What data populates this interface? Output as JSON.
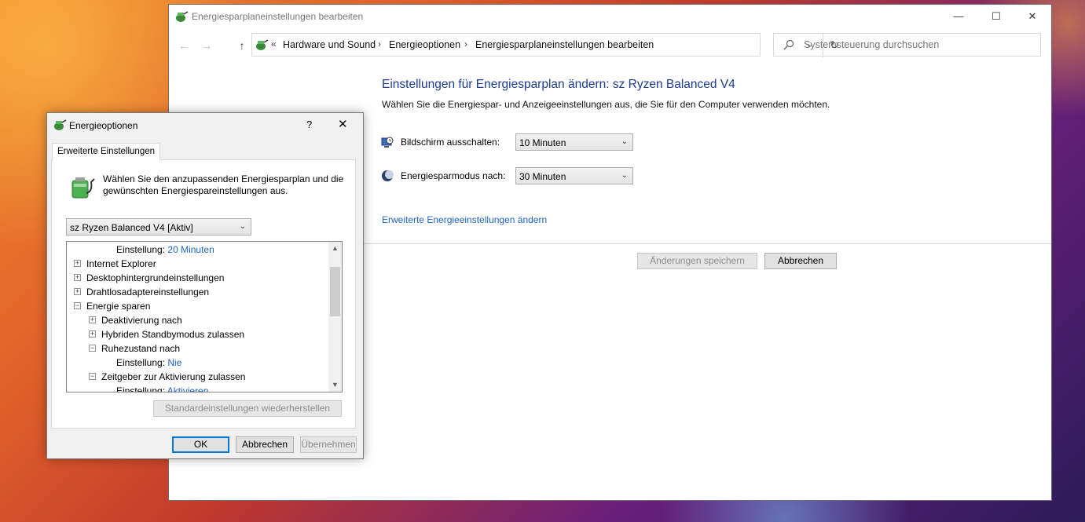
{
  "main_window": {
    "title": "Energiesparplaneinstellungen bearbeiten",
    "controls": {
      "minimize": "—",
      "maximize": "☐",
      "close": "✕"
    },
    "nav": {
      "back": "←",
      "forward": "→",
      "up": "↑"
    },
    "breadcrumb": {
      "overflow": "«",
      "items": [
        "Hardware und Sound",
        "Energieoptionen",
        "Energiesparplaneinstellungen bearbeiten"
      ],
      "separator": "›"
    },
    "refresh": "↻",
    "search_placeholder": "Systemsteuerung durchsuchen",
    "heading": "Einstellungen für Energiesparplan ändern: sz Ryzen Balanced V4",
    "subheading": "Wählen Sie die Energiespar- und Anzeigeeinstellungen aus, die Sie für den Computer verwenden möchten.",
    "settings": [
      {
        "label": "Bildschirm ausschalten:",
        "value": "10 Minuten",
        "icon": "monitor-clock-icon"
      },
      {
        "label": "Energiesparmodus nach:",
        "value": "30 Minuten",
        "icon": "moon-icon"
      }
    ],
    "advanced_link": "Erweiterte Energieeinstellungen ändern",
    "save_button": "Änderungen speichern",
    "cancel_button": "Abbrechen"
  },
  "dialog": {
    "title": "Energieoptionen",
    "help": "?",
    "close": "✕",
    "tab": "Erweiterte Einstellungen",
    "description": "Wählen Sie den anzupassenden Energiesparplan und die gewünschten Energiespareinstellungen aus.",
    "plan_select": "sz Ryzen Balanced V4 [Aktiv]",
    "tree": [
      {
        "level": 2,
        "expander": "",
        "label": "Einstellung:",
        "value": "20 Minuten"
      },
      {
        "level": 0,
        "expander": "+",
        "label": "Internet Explorer",
        "value": ""
      },
      {
        "level": 0,
        "expander": "+",
        "label": "Desktophintergrundeinstellungen",
        "value": ""
      },
      {
        "level": 0,
        "expander": "+",
        "label": "Drahtlosadaptereinstellungen",
        "value": ""
      },
      {
        "level": 0,
        "expander": "−",
        "label": "Energie sparen",
        "value": ""
      },
      {
        "level": 1,
        "expander": "+",
        "label": "Deaktivierung nach",
        "value": ""
      },
      {
        "level": 1,
        "expander": "+",
        "label": "Hybriden Standbymodus zulassen",
        "value": ""
      },
      {
        "level": 1,
        "expander": "−",
        "label": "Ruhezustand nach",
        "value": ""
      },
      {
        "level": 2,
        "expander": "",
        "label": "Einstellung:",
        "value": "Nie"
      },
      {
        "level": 1,
        "expander": "−",
        "label": "Zeitgeber zur Aktivierung zulassen",
        "value": ""
      },
      {
        "level": 2,
        "expander": "",
        "label": "Einstellung:",
        "value": "Aktivieren"
      }
    ],
    "restore_button": "Standardeinstellungen wiederherstellen",
    "ok_button": "OK",
    "cancel_button": "Abbrechen",
    "apply_button": "Übernehmen"
  }
}
